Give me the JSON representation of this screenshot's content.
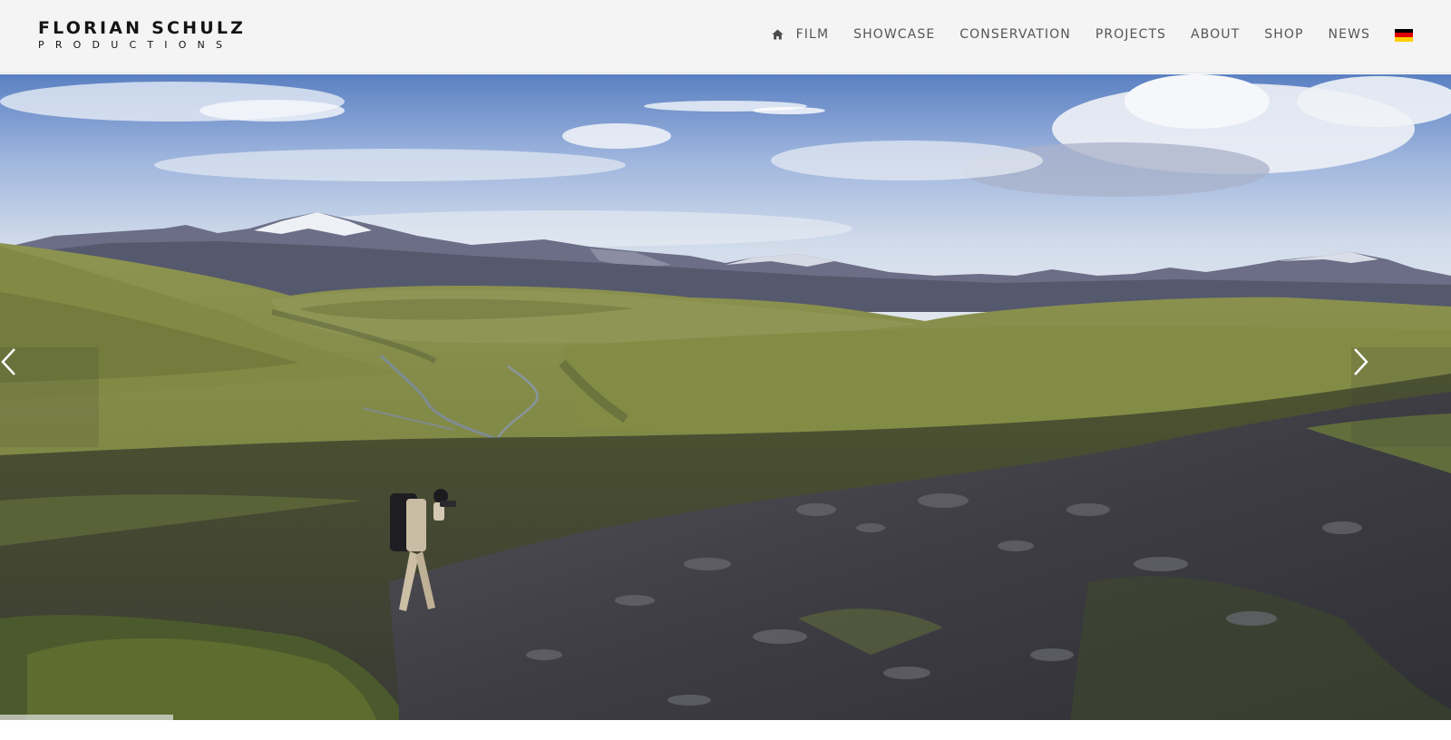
{
  "logo": {
    "name": "FLORIAN SCHULZ",
    "subtitle": "PRODUCTIONS"
  },
  "nav": {
    "home_icon": "home-icon",
    "items": [
      {
        "label": "FILM"
      },
      {
        "label": "SHOWCASE"
      },
      {
        "label": "CONSERVATION"
      },
      {
        "label": "PROJECTS"
      },
      {
        "label": "ABOUT"
      },
      {
        "label": "SHOP"
      },
      {
        "label": "NEWS"
      }
    ],
    "language_flag": {
      "icon": "german-flag-icon",
      "colors": [
        "#000000",
        "#dd0000",
        "#ffce00"
      ]
    }
  },
  "slider": {
    "prev_icon": "chevron-left-icon",
    "next_icon": "chevron-right-icon",
    "progress": 0.12
  },
  "colors": {
    "header_bg": "#f4f4f4",
    "nav_text": "#555555",
    "logo_text": "#141414"
  }
}
